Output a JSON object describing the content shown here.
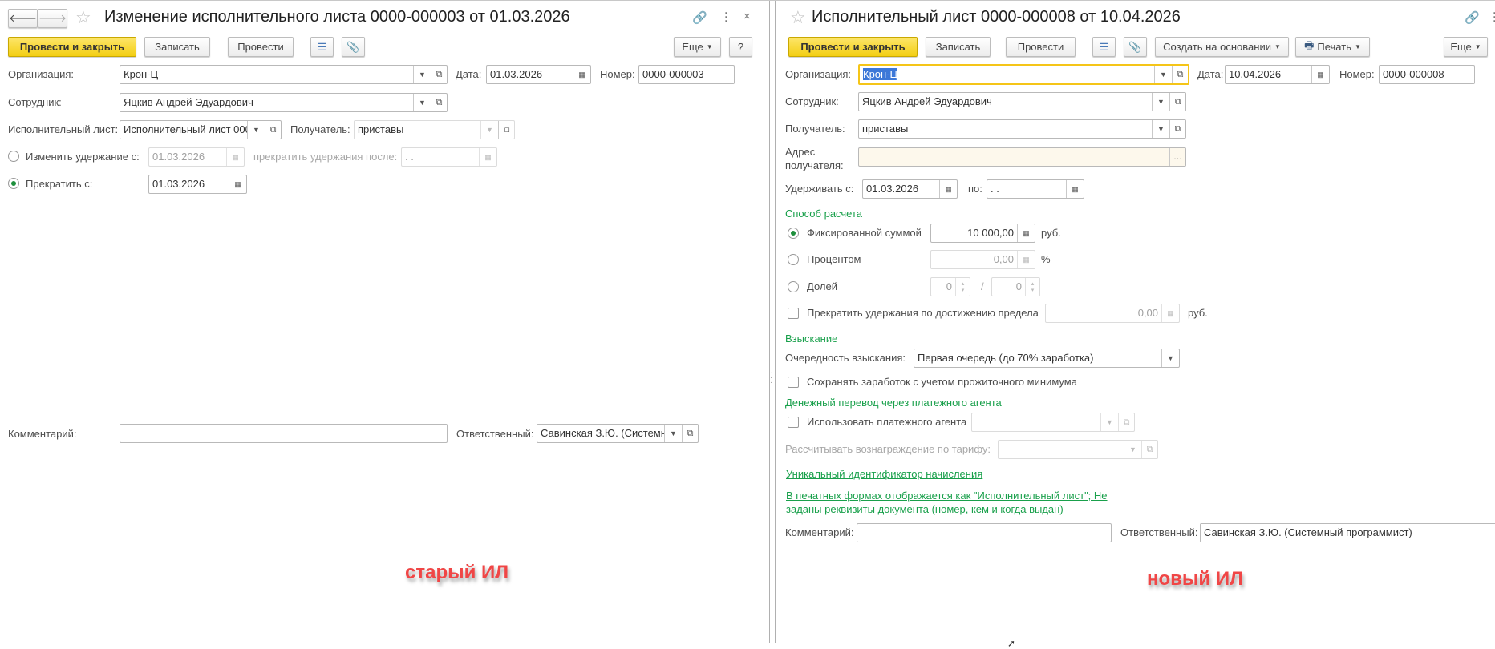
{
  "left": {
    "title": "Изменение исполнительного листа 0000-000003 от 01.03.2026",
    "toolbar": {
      "post_close": "Провести и закрыть",
      "save": "Записать",
      "post": "Провести",
      "more": "Еще",
      "help": "?"
    },
    "org_label": "Организация:",
    "org_value": "Крон-Ц",
    "date_label": "Дата:",
    "date_value": "01.03.2026",
    "number_label": "Номер:",
    "number_value": "0000-000003",
    "employee_label": "Сотрудник:",
    "employee_value": "Яцкив Андрей Эдуардович",
    "writ_label": "Исполнительный лист:",
    "writ_value": "Исполнительный лист 000",
    "recipient_label": "Получатель:",
    "recipient_value": "приставы",
    "change_label": "Изменить удержание с:",
    "change_date": "01.03.2026",
    "stop_after_label": "прекратить удержания после:",
    "stop_after_value": " .  .",
    "stop_label": "Прекратить с:",
    "stop_date": "01.03.2026",
    "comment_label": "Комментарий:",
    "comment_value": "",
    "responsible_label": "Ответственный:",
    "responsible_value": "Савинская З.Ю. (Системный программист)",
    "annotation": "старый ИЛ"
  },
  "right": {
    "title": "Исполнительный лист 0000-000008 от 10.04.2026",
    "toolbar": {
      "post_close": "Провести и закрыть",
      "save": "Записать",
      "post": "Провести",
      "create_based": "Создать на основании",
      "print": "Печать",
      "more": "Еще"
    },
    "org_label": "Организация:",
    "org_value": "Крон-Ц",
    "date_label": "Дата:",
    "date_value": "10.04.2026",
    "number_label": "Номер:",
    "number_value": "0000-000008",
    "employee_label": "Сотрудник:",
    "employee_value": "Яцкив Андрей Эдуардович",
    "recipient_label": "Получатель:",
    "recipient_value": "приставы",
    "address_label_1": "Адрес",
    "address_label_2": "получателя:",
    "address_value": "",
    "hold_from_label": "Удерживать с:",
    "hold_from_value": "01.03.2026",
    "hold_to_label": "по:",
    "hold_to_value": " .  .",
    "calc_section": "Способ расчета",
    "fixed_label": "Фиксированной суммой",
    "fixed_value": "10 000,00",
    "rub": "руб.",
    "percent_label": "Процентом",
    "percent_value": "0,00",
    "percent_sign": "%",
    "share_label": "Долей",
    "share_num": "0",
    "share_sep": "/",
    "share_den": "0",
    "limit_label": "Прекратить удержания по достижению предела",
    "limit_value": "0,00",
    "collection_section": "Взыскание",
    "priority_label": "Очередность взыскания:",
    "priority_value": "Первая очередь (до 70% заработка)",
    "subsistence_label": "Сохранять заработок с учетом прожиточного минимума",
    "transfer_section": "Денежный перевод через платежного агента",
    "use_agent_label": "Использовать платежного агента",
    "agent_value": "",
    "tariff_label": "Рассчитывать вознаграждение по тарифу:",
    "tariff_value": "",
    "uid_link": "Уникальный идентификатор начисления",
    "print_link_1": "В печатных формах отображается как \"Исполнительный лист\"; Не",
    "print_link_2": "заданы реквизиты документа (номер, кем и когда выдан)",
    "comment_label": "Комментарий:",
    "comment_value": "",
    "responsible_label": "Ответственный:",
    "responsible_value": "Савинская З.Ю. (Системный программист)",
    "annotation": "новый ИЛ"
  }
}
